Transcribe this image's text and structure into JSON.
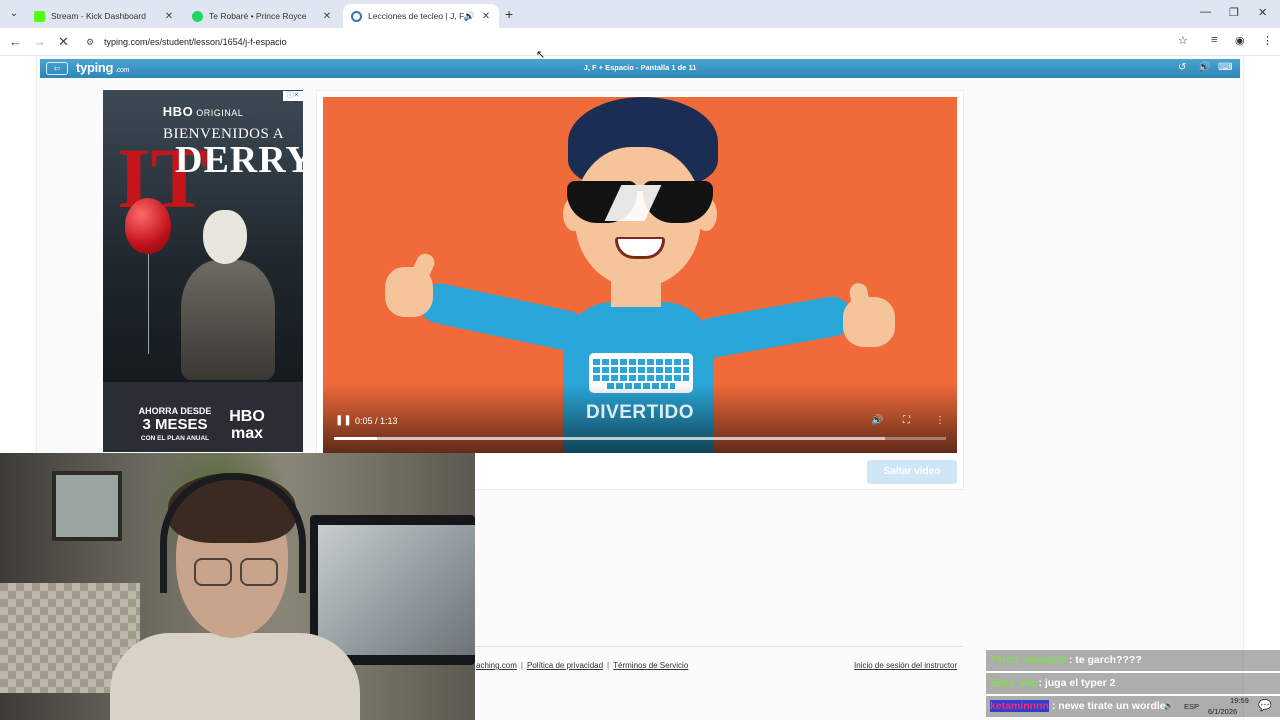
{
  "browser": {
    "tabs": [
      {
        "label": "Stream - Kick Dashboard",
        "favicon_color": "#53fc18",
        "active": false
      },
      {
        "label": "Te Robaré • Prince Royce",
        "favicon_color": "#1ed760",
        "active": false
      },
      {
        "label": "Lecciones de tecleo | J, F +",
        "favicon_color": "#3a6fb5",
        "active": true
      }
    ],
    "new_tab": "+",
    "url": "typing.com/es/student/lesson/1654/j-f-espacio"
  },
  "typing_bar": {
    "logo": "typing",
    "logo_suffix": ".com",
    "lesson_title": "J, F + Espacio - Pantalla 1 de 11"
  },
  "ad": {
    "brand": "HBO",
    "brand_suffix": "ORIGINAL",
    "welcome": "BIENVENIDOS A",
    "title": "DERRY",
    "it": "IT",
    "cta_line1": "AHORRA DESDE",
    "cta_line2": "3 MESES",
    "cta_line3": "CON EL PLAN ANUAL",
    "max_line1": "HBO",
    "max_line2": "max"
  },
  "video": {
    "caption": "DIVERTIDO",
    "time": "0:05 / 1:13",
    "progress": 0.07,
    "buffered": 0.9
  },
  "skip_button": "Saltar video",
  "footer": {
    "link1": "aching.com",
    "link2": "Política de privacidad",
    "link3": "Términos de Servicio",
    "instructor": "Inicio de sesión del instructor"
  },
  "chat": [
    {
      "user": "T0rch_messi10",
      "message": ": te garch????"
    },
    {
      "user": "Enzo_wq",
      "message": ": juga el typer 2"
    },
    {
      "user": "ketaminnnn",
      "message": ": newe tirate un wordle"
    }
  ],
  "taskbar": {
    "lang": "ESP",
    "time": "19:59",
    "date": "6/1/2026"
  }
}
